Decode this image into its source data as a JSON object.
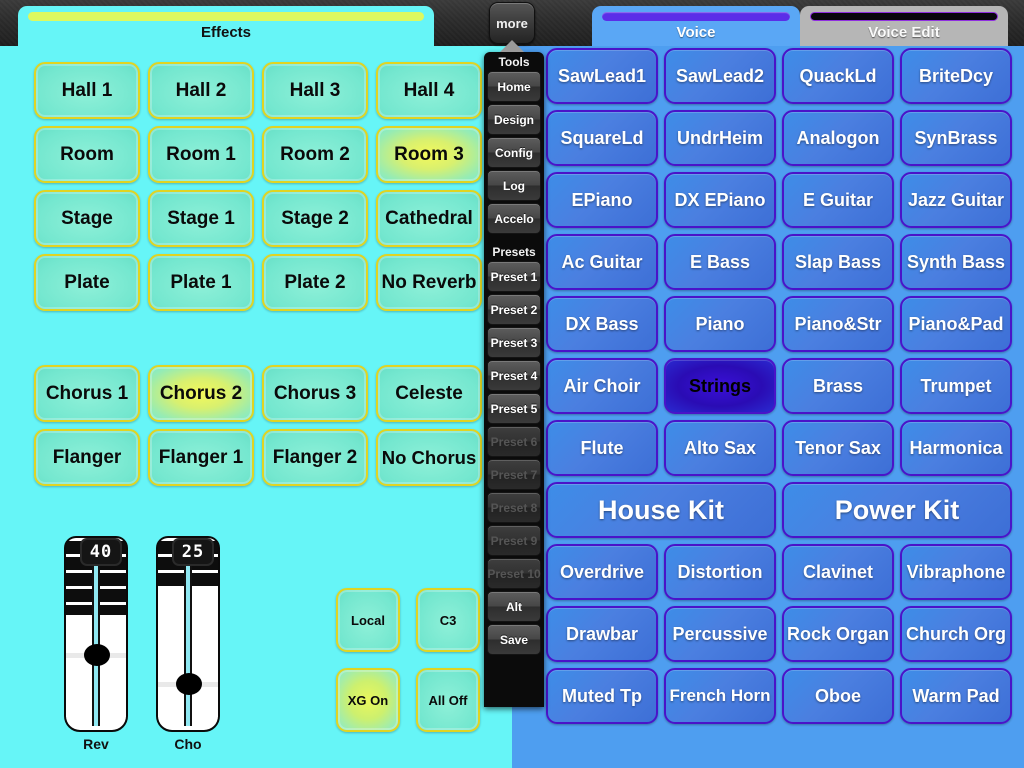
{
  "tabs": [
    {
      "label": "Effects",
      "accent": "#ddf95f"
    },
    {
      "label": "Voice",
      "accent": "#5b2ee8"
    },
    {
      "label": "Voice Edit",
      "accent": "#08060c"
    }
  ],
  "more_button": {
    "label": "more"
  },
  "effects_panel": {
    "reverb_buttons": [
      {
        "label": "Hall 1",
        "selected": false
      },
      {
        "label": "Hall 2",
        "selected": false
      },
      {
        "label": "Hall 3",
        "selected": false
      },
      {
        "label": "Hall 4",
        "selected": false
      },
      {
        "label": "Room",
        "selected": false
      },
      {
        "label": "Room 1",
        "selected": false
      },
      {
        "label": "Room 2",
        "selected": false
      },
      {
        "label": "Room 3",
        "selected": true
      },
      {
        "label": "Stage",
        "selected": false
      },
      {
        "label": "Stage 1",
        "selected": false
      },
      {
        "label": "Stage 2",
        "selected": false
      },
      {
        "label": "Cathedral",
        "selected": false
      },
      {
        "label": "Plate",
        "selected": false
      },
      {
        "label": "Plate 1",
        "selected": false
      },
      {
        "label": "Plate 2",
        "selected": false
      },
      {
        "label": "No Reverb",
        "selected": false
      }
    ],
    "chorus_buttons": [
      {
        "label": "Chorus 1",
        "selected": false
      },
      {
        "label": "Chorus 2",
        "selected": true
      },
      {
        "label": "Chorus 3",
        "selected": false
      },
      {
        "label": "Celeste",
        "selected": false
      },
      {
        "label": "Flanger",
        "selected": false
      },
      {
        "label": "Flanger 1",
        "selected": false
      },
      {
        "label": "Flanger 2",
        "selected": false
      },
      {
        "label": "No Chorus",
        "selected": false
      }
    ],
    "sliders": [
      {
        "label": "Rev",
        "value": "40",
        "percent": 40
      },
      {
        "label": "Cho",
        "value": "25",
        "percent": 25
      }
    ],
    "small_buttons": [
      {
        "label": "Local",
        "selected": false
      },
      {
        "label": "C3",
        "selected": false
      },
      {
        "label": "XG On",
        "selected": true
      },
      {
        "label": "All Off",
        "selected": false
      }
    ]
  },
  "menu": {
    "tools_header": "Tools",
    "tools": [
      {
        "label": "Home",
        "disabled": false
      },
      {
        "label": "Design",
        "disabled": false
      },
      {
        "label": "Config",
        "disabled": false
      },
      {
        "label": "Log",
        "disabled": false
      },
      {
        "label": "Accelo",
        "disabled": false
      }
    ],
    "presets_header": "Presets",
    "presets": [
      {
        "label": "Preset 1",
        "disabled": false
      },
      {
        "label": "Preset 2",
        "disabled": false
      },
      {
        "label": "Preset 3",
        "disabled": false
      },
      {
        "label": "Preset 4",
        "disabled": false
      },
      {
        "label": "Preset 5",
        "disabled": false
      },
      {
        "label": "Preset 6",
        "disabled": true
      },
      {
        "label": "Preset 7",
        "disabled": true
      },
      {
        "label": "Preset 8",
        "disabled": true
      },
      {
        "label": "Preset 9",
        "disabled": true
      },
      {
        "label": "Preset 10",
        "disabled": true
      },
      {
        "label": "Alt",
        "disabled": false
      },
      {
        "label": "Save",
        "disabled": false
      }
    ]
  },
  "voice_panel": {
    "voices": [
      {
        "label": "SawLead1",
        "selected": false,
        "wide": false
      },
      {
        "label": "SawLead2",
        "selected": false,
        "wide": false
      },
      {
        "label": "QuackLd",
        "selected": false,
        "wide": false
      },
      {
        "label": "BriteDcy",
        "selected": false,
        "wide": false
      },
      {
        "label": "SquareLd",
        "selected": false,
        "wide": false
      },
      {
        "label": "UndrHeim",
        "selected": false,
        "wide": false
      },
      {
        "label": "Analogon",
        "selected": false,
        "wide": false
      },
      {
        "label": "SynBrass",
        "selected": false,
        "wide": false
      },
      {
        "label": "EPiano",
        "selected": false,
        "wide": false
      },
      {
        "label": "DX EPiano",
        "selected": false,
        "wide": false
      },
      {
        "label": "E Guitar",
        "selected": false,
        "wide": false
      },
      {
        "label": "Jazz Guitar",
        "selected": false,
        "wide": false
      },
      {
        "label": "Ac Guitar",
        "selected": false,
        "wide": false
      },
      {
        "label": "E Bass",
        "selected": false,
        "wide": false
      },
      {
        "label": "Slap Bass",
        "selected": false,
        "wide": false
      },
      {
        "label": "Synth Bass",
        "selected": false,
        "wide": false
      },
      {
        "label": "DX Bass",
        "selected": false,
        "wide": false
      },
      {
        "label": "Piano",
        "selected": false,
        "wide": false
      },
      {
        "label": "Piano&Str",
        "selected": false,
        "wide": false
      },
      {
        "label": "Piano&Pad",
        "selected": false,
        "wide": false
      },
      {
        "label": "Air Choir",
        "selected": false,
        "wide": false
      },
      {
        "label": "Strings",
        "selected": true,
        "wide": false
      },
      {
        "label": "Brass",
        "selected": false,
        "wide": false
      },
      {
        "label": "Trumpet",
        "selected": false,
        "wide": false
      },
      {
        "label": "Flute",
        "selected": false,
        "wide": false
      },
      {
        "label": "Alto Sax",
        "selected": false,
        "wide": false
      },
      {
        "label": "Tenor Sax",
        "selected": false,
        "wide": false
      },
      {
        "label": "Harmonica",
        "selected": false,
        "wide": false
      },
      {
        "label": "House Kit",
        "selected": false,
        "wide": true
      },
      {
        "label": "Power Kit",
        "selected": false,
        "wide": true
      },
      {
        "label": "Overdrive",
        "selected": false,
        "wide": false
      },
      {
        "label": "Distortion",
        "selected": false,
        "wide": false
      },
      {
        "label": "Clavinet",
        "selected": false,
        "wide": false
      },
      {
        "label": "Vibraphone",
        "selected": false,
        "wide": false
      },
      {
        "label": "Drawbar",
        "selected": false,
        "wide": false
      },
      {
        "label": "Percussive",
        "selected": false,
        "wide": false
      },
      {
        "label": "Rock Organ",
        "selected": false,
        "wide": false
      },
      {
        "label": "Church Org",
        "selected": false,
        "wide": false
      },
      {
        "label": "Muted Tp",
        "selected": false,
        "wide": false
      },
      {
        "label": "French Horn",
        "selected": false,
        "wide": false
      },
      {
        "label": "Oboe",
        "selected": false,
        "wide": false
      },
      {
        "label": "Warm Pad",
        "selected": false,
        "wide": false
      }
    ]
  }
}
